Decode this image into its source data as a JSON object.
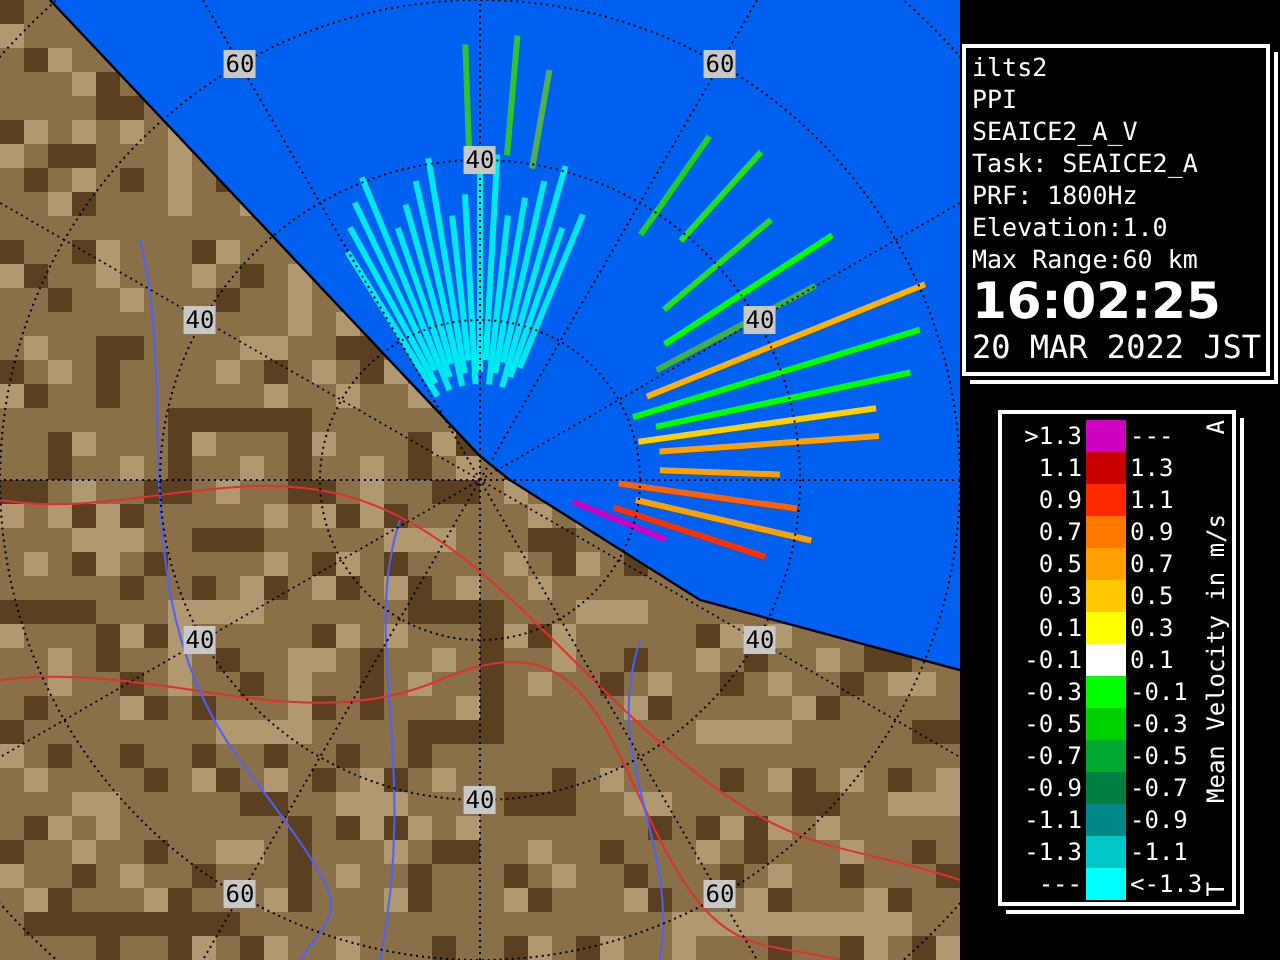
{
  "map": {
    "range_labels": [
      "60",
      "60",
      "40",
      "40",
      "40",
      "40",
      "40",
      "40",
      "60",
      "60"
    ]
  },
  "info": {
    "lines": [
      "ilts2",
      "PPI",
      "SEAICE2_A_V",
      "Task: SEAICE2_A",
      "PRF: 1800Hz",
      "Elevation:1.0",
      "Max Range:60 km"
    ],
    "time": "16:02:25",
    "date": "20 MAR 2022 JST"
  },
  "legend": {
    "title": "Mean Velocity in m/s",
    "top_mark": "A",
    "bottom_mark": "T",
    "rows": [
      {
        "low": ">1.3",
        "high": "---",
        "color": "#d000c0"
      },
      {
        "low": "1.1",
        "high": "1.3",
        "color": "#c80000"
      },
      {
        "low": "0.9",
        "high": "1.1",
        "color": "#ff2800"
      },
      {
        "low": "0.7",
        "high": "0.9",
        "color": "#ff7800"
      },
      {
        "low": "0.5",
        "high": "0.7",
        "color": "#ffa000"
      },
      {
        "low": "0.3",
        "high": "0.5",
        "color": "#ffc800"
      },
      {
        "low": "0.1",
        "high": "0.3",
        "color": "#ffff00"
      },
      {
        "low": "-0.1",
        "high": "0.1",
        "color": "#ffffff"
      },
      {
        "low": "-0.3",
        "high": "-0.1",
        "color": "#00ff00"
      },
      {
        "low": "-0.5",
        "high": "-0.3",
        "color": "#00d000"
      },
      {
        "low": "-0.7",
        "high": "-0.5",
        "color": "#00a830"
      },
      {
        "low": "-0.9",
        "high": "-0.7",
        "color": "#008040"
      },
      {
        "low": "-1.1",
        "high": "-0.9",
        "color": "#008888"
      },
      {
        "low": "-1.3",
        "high": "-1.1",
        "color": "#00c8c8"
      },
      {
        "low": "---",
        "high": "<-1.3",
        "color": "#00ffff"
      }
    ]
  }
}
